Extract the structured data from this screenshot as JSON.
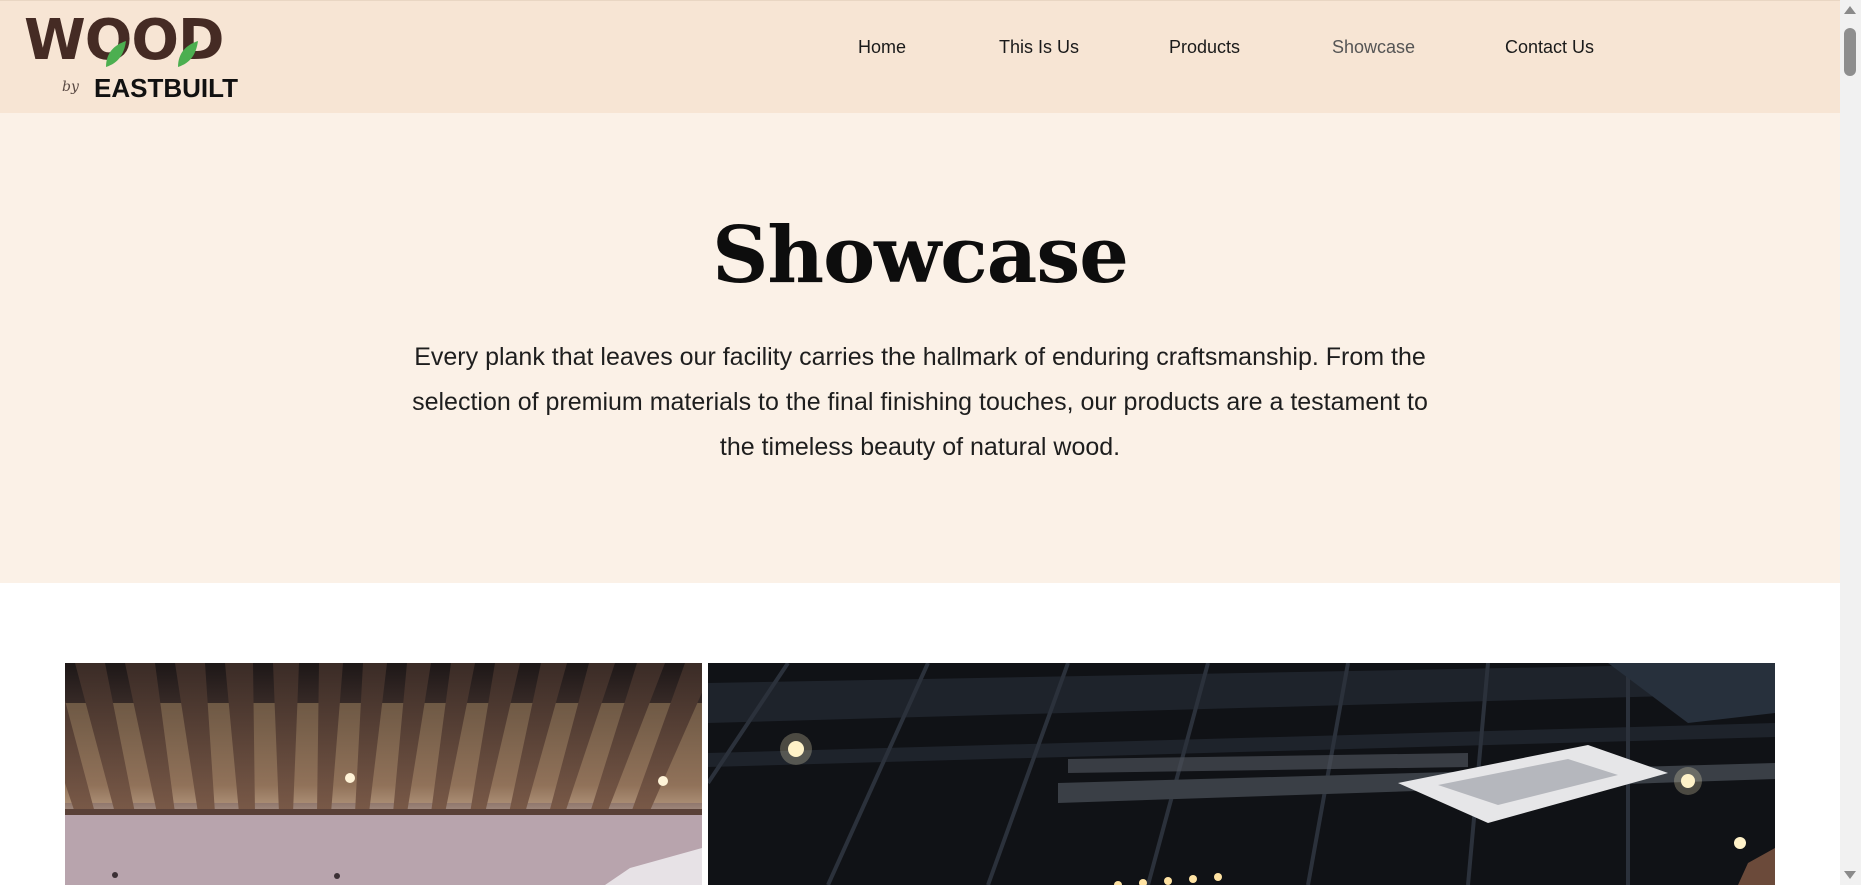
{
  "brand": {
    "wood_text": "WOOD",
    "by_text": "by",
    "company_text": "EASTBUILT"
  },
  "nav": {
    "items": [
      {
        "label": "Home"
      },
      {
        "label": "This Is Us"
      },
      {
        "label": "Products"
      },
      {
        "label": "Showcase",
        "active": true
      },
      {
        "label": "Contact Us"
      }
    ]
  },
  "hero": {
    "title": "Showcase",
    "description": "Every plank that leaves our facility carries the hallmark of enduring craftsmanship. From the selection of premium materials to the final finishing touches, our products are a testament to the timeless beauty of natural wood."
  },
  "colors": {
    "header_bg": "#f7e5d4",
    "hero_bg": "#fbf1e7",
    "logo_brown": "#452b24",
    "leaf_green": "#4caf50"
  }
}
